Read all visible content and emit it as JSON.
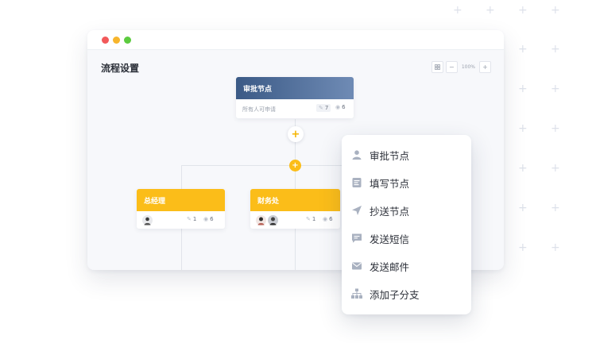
{
  "page_title": "流程设置",
  "zoom": {
    "minus": "−",
    "level": "100%",
    "plus": "+"
  },
  "approver_node": {
    "title": "审批节点",
    "assignee": "所有人可申请",
    "edit_count": "7",
    "view_count": "6"
  },
  "branch_nodes": [
    {
      "title": "总经理",
      "edit_count": "1",
      "view_count": "6"
    },
    {
      "title": "财务处",
      "edit_count": "1",
      "view_count": "6"
    }
  ],
  "add_button": "+",
  "menu": {
    "items": [
      {
        "label": "审批节点",
        "icon": "user-icon"
      },
      {
        "label": "填写节点",
        "icon": "form-icon"
      },
      {
        "label": "抄送节点",
        "icon": "send-icon"
      },
      {
        "label": "发送短信",
        "icon": "message-icon"
      },
      {
        "label": "发送邮件",
        "icon": "mail-icon"
      },
      {
        "label": "添加子分支",
        "icon": "branch-icon"
      }
    ]
  },
  "colors": {
    "accent_yellow": "#fbbd19",
    "header_blue": "#3b5a86",
    "icon_gray": "#a9b1c0"
  }
}
